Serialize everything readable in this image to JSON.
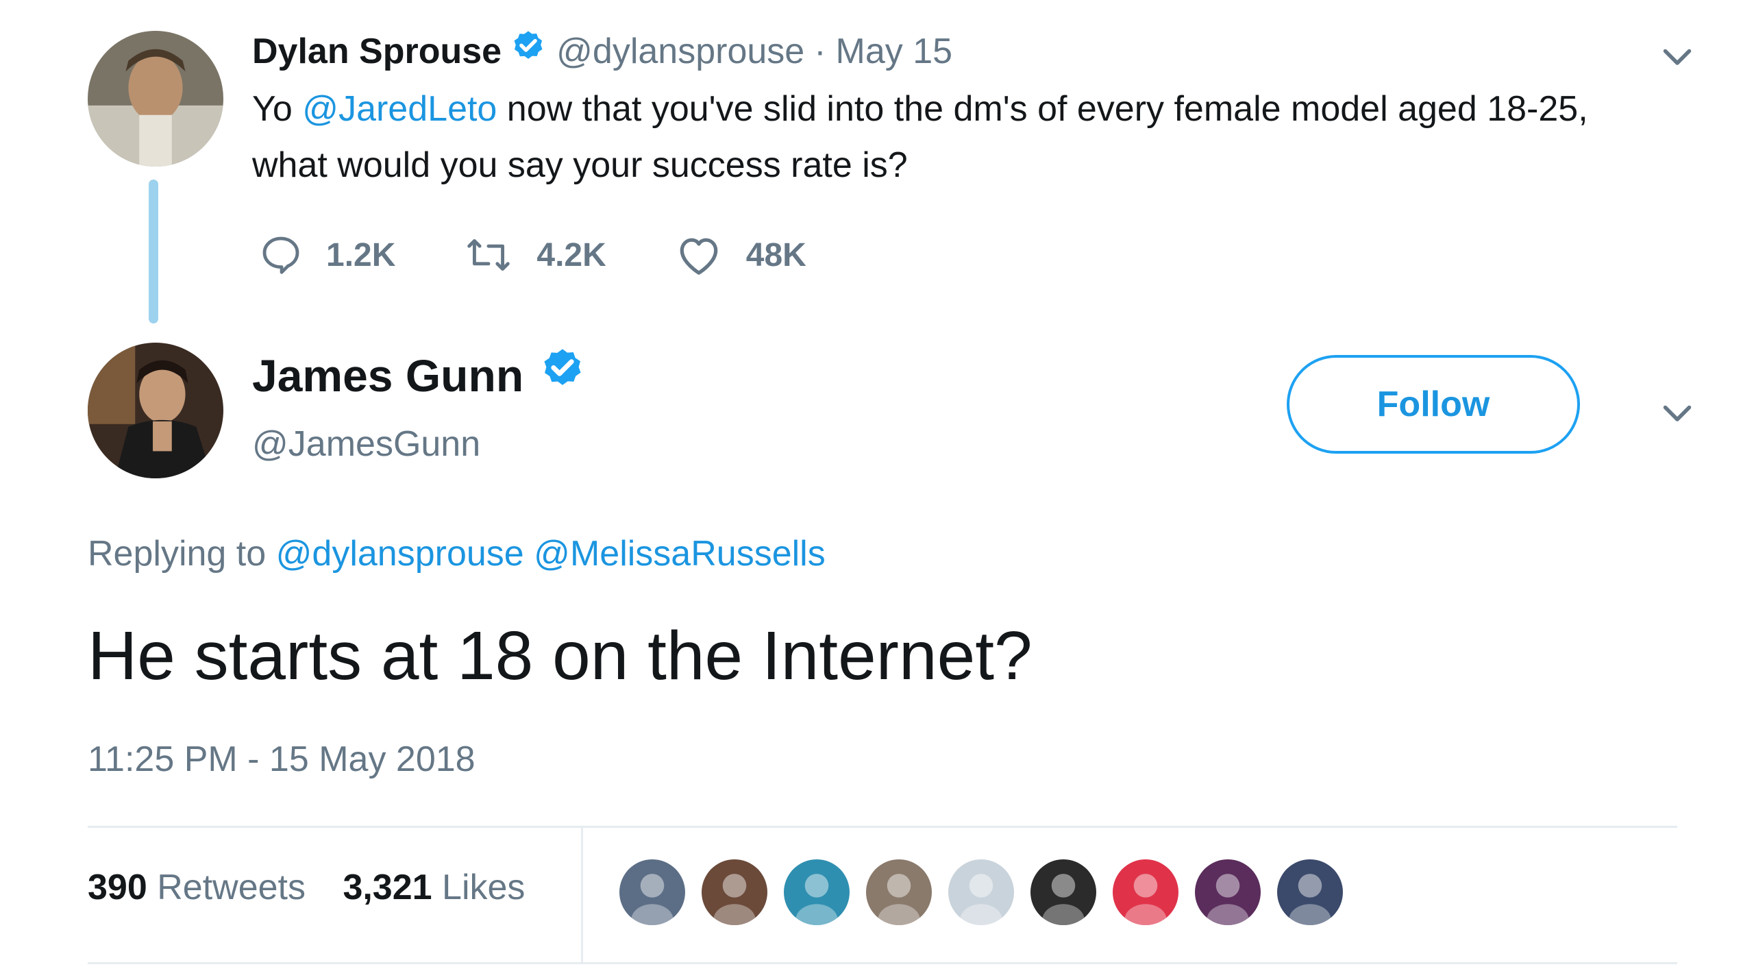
{
  "parent_tweet": {
    "author_name": "Dylan Sprouse",
    "handle": "@dylansprouse",
    "separator": "·",
    "date": "May 15",
    "text_prefix": "Yo ",
    "mention": "@JaredLeto",
    "text_rest": " now that you've slid into the dm's of every female model aged 18-25, what would you say your success rate is?",
    "reply_count": "1.2K",
    "retweet_count": "4.2K",
    "like_count": "48K",
    "avatar_icon": "dylan-avatar"
  },
  "reply_tweet": {
    "author_name": "James Gunn",
    "handle": "@JamesGunn",
    "follow_label": "Follow",
    "replying_to_label": "Replying to",
    "replying_to_1": "@dylansprouse",
    "replying_to_2": "@MelissaRussells",
    "text": "He starts at 18 on the Internet?",
    "timestamp": "11:25 PM - 15 May 2018",
    "retweets_count": "390",
    "retweets_label": "Retweets",
    "likes_count": "3,321",
    "likes_label": "Likes",
    "avatar_icon": "james-avatar"
  },
  "colors": {
    "link": "#1b95e0",
    "muted": "#657786",
    "verified": "#1da1f2",
    "thread_line": "#9dd2ee"
  },
  "likers": [
    {
      "name": "liker-avatar-1",
      "color": "#5c6e86"
    },
    {
      "name": "liker-avatar-2",
      "color": "#6b4a3a"
    },
    {
      "name": "liker-avatar-3",
      "color": "#2f8fb0"
    },
    {
      "name": "liker-avatar-4",
      "color": "#8a7a6c"
    },
    {
      "name": "liker-avatar-5",
      "color": "#c9d3db"
    },
    {
      "name": "liker-avatar-6",
      "color": "#2b2b2b"
    },
    {
      "name": "liker-avatar-7",
      "color": "#e0334a"
    },
    {
      "name": "liker-avatar-8",
      "color": "#5a2d5c"
    },
    {
      "name": "liker-avatar-9",
      "color": "#3b4a6b"
    }
  ]
}
